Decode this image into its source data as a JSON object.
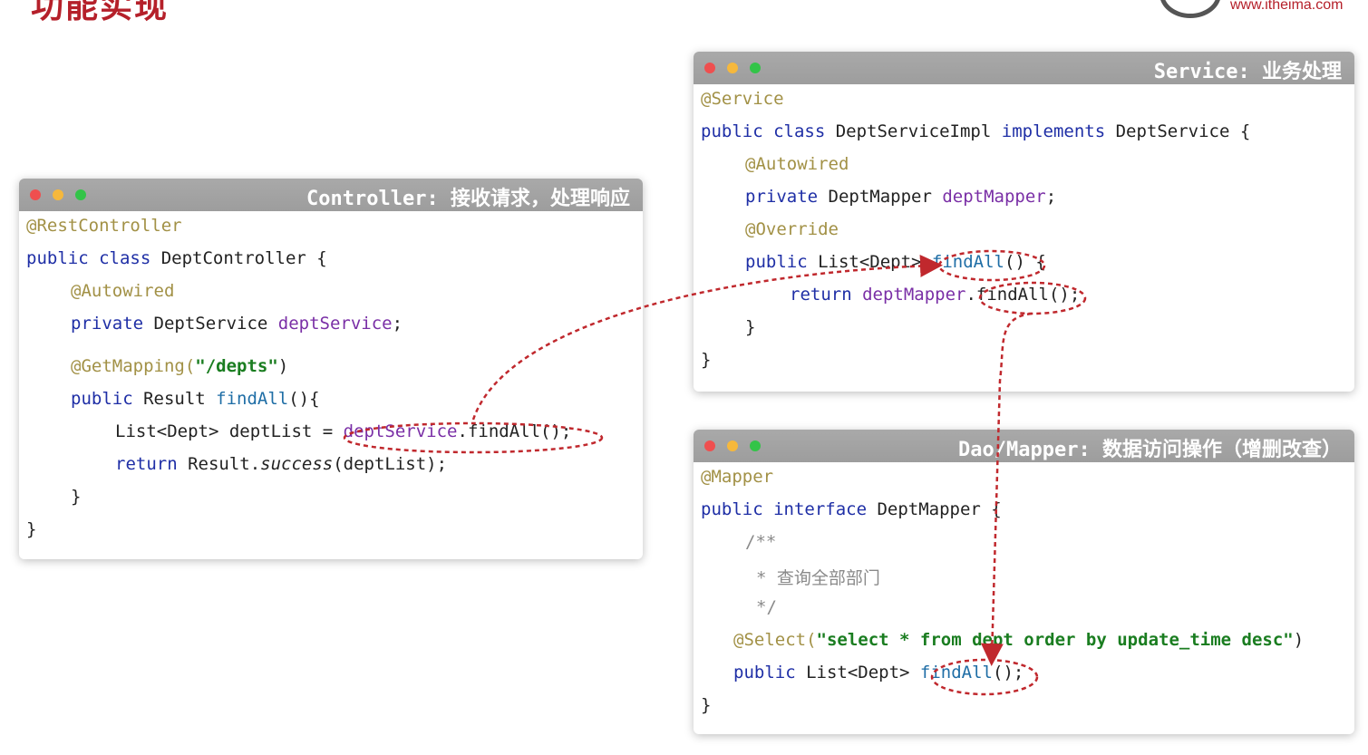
{
  "slide_title": "功能实现",
  "logo_url": "www.itheima.com",
  "controller": {
    "title": "Controller: 接收请求，处理响应",
    "lines": {
      "l1": "@RestController",
      "l2a": "public class",
      "l2b": " DeptController {",
      "l3": "@Autowired",
      "l4a": "private",
      "l4b": " DeptService ",
      "l4c": "deptService",
      "l4d": ";",
      "l5a": "@GetMapping(",
      "l5b": "\"/depts\"",
      "l5c": ")",
      "l6a": "public",
      "l6b": " Result ",
      "l6c": "findAll",
      "l6d": "(){",
      "l7a": "List<Dept> deptList = ",
      "l7b": "deptService",
      "l7c": ".findAll();",
      "l8a": "return",
      "l8b": " Result.",
      "l8c": "success",
      "l8d": "(deptList);",
      "l9": "}",
      "l10": "}"
    }
  },
  "service": {
    "title": "Service: 业务处理",
    "lines": {
      "l1": "@Service",
      "l2a": "public class",
      "l2b": " DeptServiceImpl ",
      "l2c": "implements",
      "l2d": " DeptService {",
      "l3": "@Autowired",
      "l4a": "private",
      "l4b": " DeptMapper ",
      "l4c": "deptMapper",
      "l4d": ";",
      "l5": "@Override",
      "l6a": "public",
      "l6b": " List<Dept> ",
      "l6c": "findAll",
      "l6d": "() {",
      "l7a": "return",
      "l7b": " deptMapper",
      "l7c": ".findAll();",
      "l8": "}",
      "l9": "}"
    }
  },
  "mapper": {
    "title": "Dao/Mapper: 数据访问操作（增删改查）",
    "lines": {
      "l1": "@Mapper",
      "l2a": "public interface",
      "l2b": " DeptMapper {",
      "l3": "/**",
      "l4": "* 查询全部部门",
      "l5": "*/",
      "l6a": "@Select(",
      "l6b": "\"select * from dept order by update_time desc\"",
      "l6c": ")",
      "l7a": "public",
      "l7b": " List<Dept> ",
      "l7c": "findAll",
      "l7d": "();",
      "l8": "}"
    }
  },
  "colors": {
    "title_red": "#b5202a",
    "arrow_red": "#c0282d",
    "annotation": "#a29146",
    "keyword": "#1f2fa6",
    "field": "#7a2fa6"
  }
}
